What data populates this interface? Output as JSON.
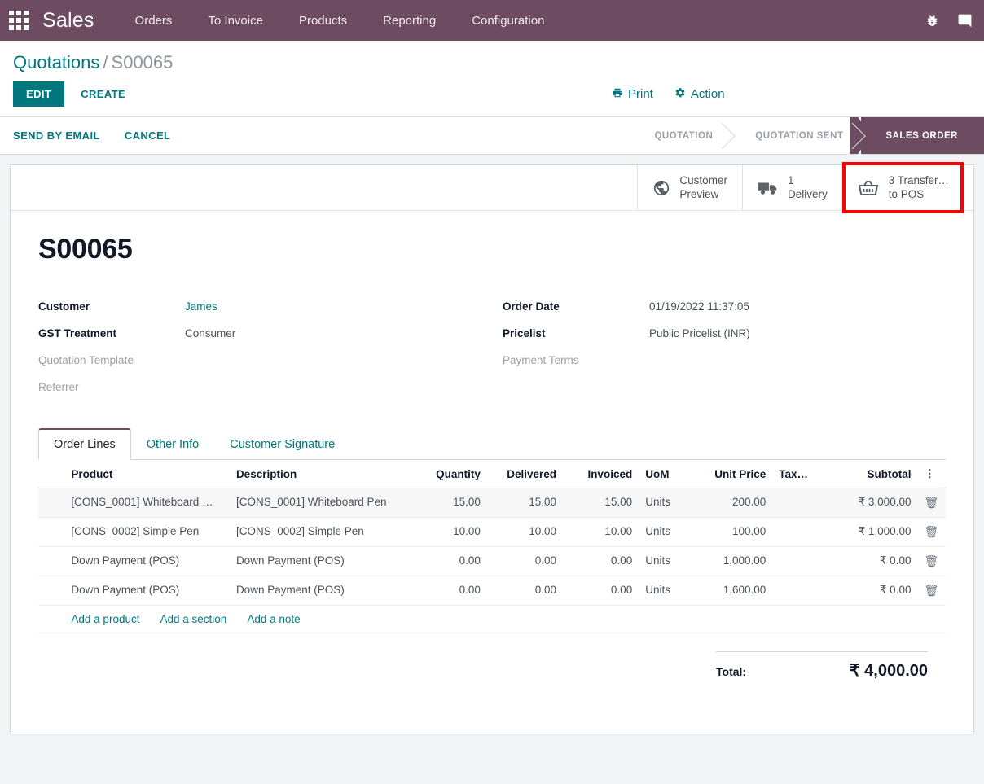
{
  "navbar": {
    "apps_icon": "apps-grid-icon",
    "brand": "Sales",
    "menu": [
      {
        "label": "Orders"
      },
      {
        "label": "To Invoice"
      },
      {
        "label": "Products"
      },
      {
        "label": "Reporting"
      },
      {
        "label": "Configuration"
      }
    ],
    "right_icons": [
      {
        "name": "bug-icon"
      },
      {
        "name": "chat-icon"
      }
    ],
    "bg_color": "#6d4c61"
  },
  "control_panel": {
    "breadcrumb_root": "Quotations",
    "breadcrumb_sep": "/",
    "breadcrumb_current": "S00065",
    "edit_label": "EDIT",
    "create_label": "CREATE",
    "print_label": "Print",
    "action_label": "Action"
  },
  "statusbar": {
    "buttons": [
      {
        "label": "SEND BY EMAIL"
      },
      {
        "label": "CANCEL"
      }
    ],
    "stages": [
      {
        "label": "QUOTATION",
        "active": false
      },
      {
        "label": "QUOTATION SENT",
        "active": false
      },
      {
        "label": "SALES ORDER",
        "active": true
      }
    ]
  },
  "smart_buttons": [
    {
      "icon": "globe-icon",
      "value": "",
      "label_line1": "Customer",
      "label_line2": "Preview",
      "highlighted": false
    },
    {
      "icon": "truck-icon",
      "value": "1",
      "label_line1": "",
      "label_line2": "Delivery",
      "highlighted": false
    },
    {
      "icon": "basket-icon",
      "value": "3",
      "label_line1": "Transfer…",
      "label_line2": "to POS",
      "highlighted": true
    }
  ],
  "highlight_color": "#fe0000",
  "accent_color": "#00787d",
  "record": {
    "title": "S00065",
    "left_fields": [
      {
        "label": "Customer",
        "value": "James",
        "label_muted": false,
        "value_link": true
      },
      {
        "label": "GST Treatment",
        "value": "Consumer",
        "label_muted": false,
        "value_link": false
      },
      {
        "label": "Quotation Template",
        "value": "",
        "label_muted": true,
        "value_link": false
      },
      {
        "label": "Referrer",
        "value": "",
        "label_muted": true,
        "value_link": false
      }
    ],
    "right_fields": [
      {
        "label": "Order Date",
        "value": "01/19/2022 11:37:05",
        "label_muted": false,
        "value_link": false
      },
      {
        "label": "Pricelist",
        "value": "Public Pricelist (INR)",
        "label_muted": false,
        "value_link": false
      },
      {
        "label": "Payment Terms",
        "value": "",
        "label_muted": true,
        "value_link": false
      }
    ]
  },
  "tabs": [
    {
      "label": "Order Lines",
      "active": true
    },
    {
      "label": "Other Info",
      "active": false
    },
    {
      "label": "Customer Signature",
      "active": false
    }
  ],
  "order_lines": {
    "columns": [
      "Product",
      "Description",
      "Quantity",
      "Delivered",
      "Invoiced",
      "UoM",
      "Unit Price",
      "Tax…",
      "Subtotal"
    ],
    "options_icon": "vertical-dots-icon",
    "rows": [
      {
        "product": "[CONS_0001] Whiteboard …",
        "description": "[CONS_0001] Whiteboard Pen",
        "quantity": "15.00",
        "delivered": "15.00",
        "invoiced": "15.00",
        "uom": "Units",
        "unit_price": "200.00",
        "tax": "",
        "subtotal": "₹ 3,000.00",
        "hovered": true
      },
      {
        "product": "[CONS_0002] Simple Pen",
        "description": "[CONS_0002] Simple Pen",
        "quantity": "10.00",
        "delivered": "10.00",
        "invoiced": "10.00",
        "uom": "Units",
        "unit_price": "100.00",
        "tax": "",
        "subtotal": "₹ 1,000.00",
        "hovered": false
      },
      {
        "product": "Down Payment (POS)",
        "description": "Down Payment (POS)",
        "quantity": "0.00",
        "delivered": "0.00",
        "invoiced": "0.00",
        "uom": "Units",
        "unit_price": "1,000.00",
        "tax": "",
        "subtotal": "₹ 0.00",
        "hovered": false
      },
      {
        "product": "Down Payment (POS)",
        "description": "Down Payment (POS)",
        "quantity": "0.00",
        "delivered": "0.00",
        "invoiced": "0.00",
        "uom": "Units",
        "unit_price": "1,600.00",
        "tax": "",
        "subtotal": "₹ 0.00",
        "hovered": false
      }
    ],
    "add_links": [
      {
        "label": "Add a product"
      },
      {
        "label": "Add a section"
      },
      {
        "label": "Add a note"
      }
    ]
  },
  "totals": {
    "label": "Total:",
    "value": "₹ 4,000.00"
  }
}
